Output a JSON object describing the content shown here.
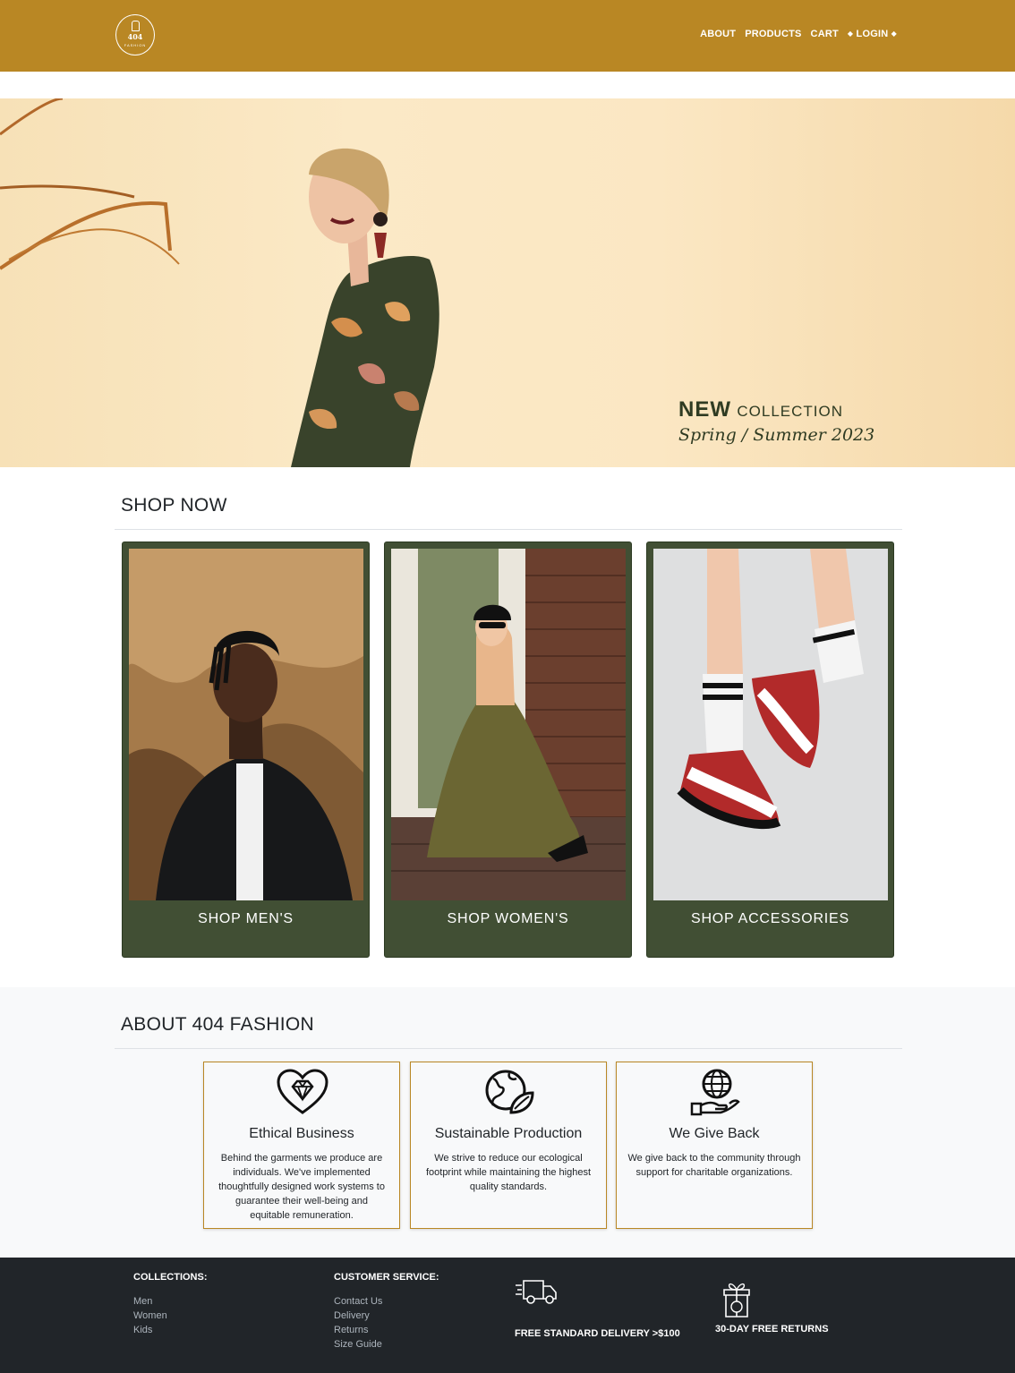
{
  "header": {
    "logo_number": "404",
    "logo_subtext": "FASHION",
    "nav": [
      "ABOUT",
      "PRODUCTS",
      "CART"
    ],
    "login_label": "LOGIN",
    "login_glyph": "◆"
  },
  "hero": {
    "new_word": "NEW",
    "collection_word": "COLLECTION",
    "season": "Spring / Summer 2023"
  },
  "shop": {
    "title": "SHOP NOW",
    "cards": [
      {
        "label": "SHOP MEN'S",
        "image": "man-in-black-jacket"
      },
      {
        "label": "SHOP WOMEN'S",
        "image": "woman-in-olive-dress"
      },
      {
        "label": "SHOP ACCESSORIES",
        "image": "legs-in-sneakers"
      }
    ]
  },
  "about": {
    "title": "ABOUT 404 FASHION",
    "features": [
      {
        "icon": "heart-diamond-icon",
        "title": "Ethical Business",
        "desc": "Behind the garments we produce are individuals. We've implemented thoughtfully designed work systems to guarantee their well-being and equitable remuneration."
      },
      {
        "icon": "earth-leaf-icon",
        "title": "Sustainable Production",
        "desc": "We strive to reduce our ecological footprint while maintaining the highest quality standards."
      },
      {
        "icon": "hand-globe-icon",
        "title": "We Give Back",
        "desc": "We give back to the community through support for charitable organizations."
      }
    ]
  },
  "footer": {
    "collections_heading": "COLLECTIONS:",
    "collections": [
      "Men",
      "Women",
      "Kids"
    ],
    "service_heading": "CUSTOMER SERVICE:",
    "service": [
      "Contact Us",
      "Delivery",
      "Returns",
      "Size Guide"
    ],
    "perk_delivery": "FREE STANDARD DELIVERY >$100",
    "perk_returns": "30-DAY FREE RETURNS"
  },
  "colors": {
    "header": "#b98724",
    "card": "#414f34",
    "footer": "#212529",
    "section_bg": "#f8f9fa"
  }
}
